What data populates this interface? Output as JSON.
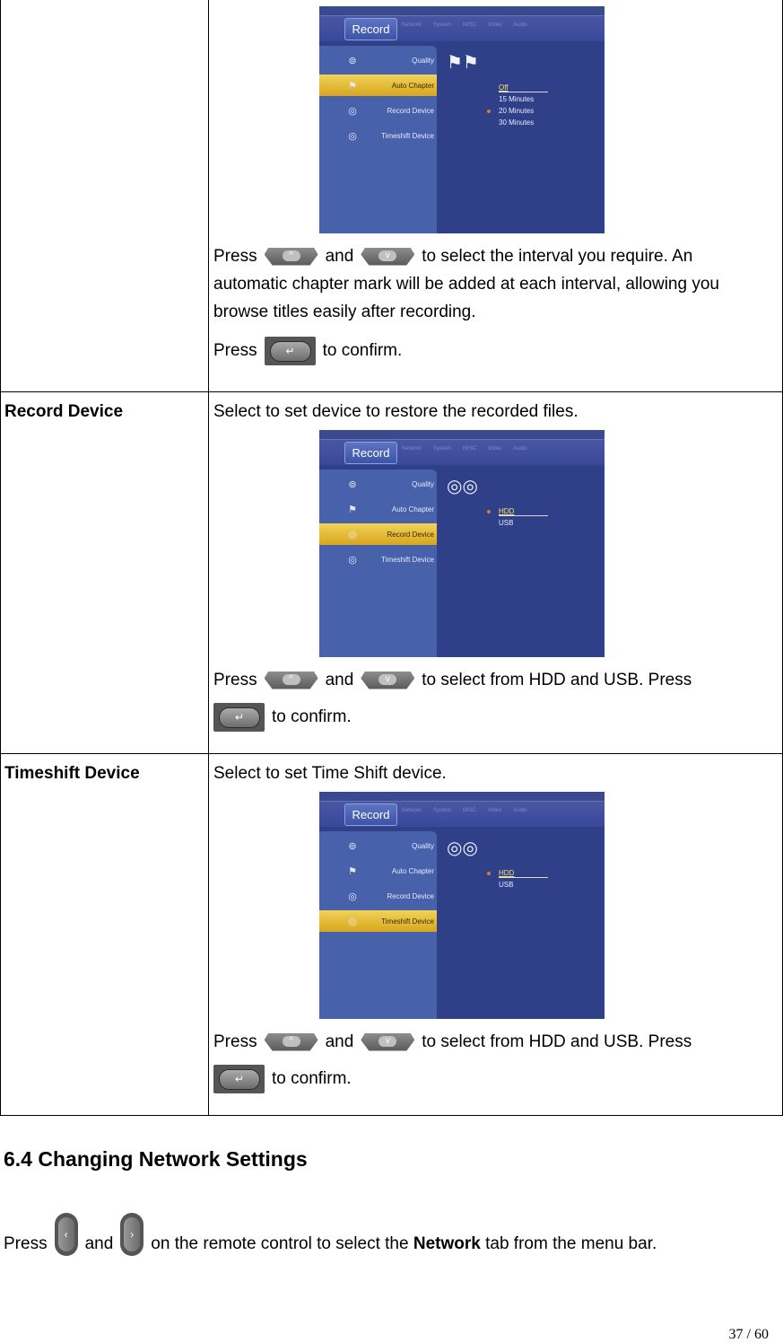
{
  "menu_tabs": [
    "Record",
    "Network",
    "System",
    "MISC",
    "Video",
    "Audio"
  ],
  "menu_items": [
    "Quality",
    "Auto Chapter",
    "Record Device",
    "Timeshift Device"
  ],
  "rows": [
    {
      "label": "",
      "screenshot": {
        "selected_item": "Auto Chapter",
        "options": [
          "Off",
          "15 Minutes",
          "20 Minutes",
          "30 Minutes"
        ],
        "highlighted_option": "Off",
        "marked_option": "20 Minutes"
      },
      "para1_pre": "Press",
      "para1_and": "and",
      "para1_post": "to select the interval you require. An",
      "para1_cont1": "automatic chapter mark will be added at each interval, allowing you",
      "para1_cont2": "browse titles easily after recording.",
      "para2_pre": "Press",
      "para2_post": "to confirm."
    },
    {
      "label": "Record Device",
      "intro": "Select to set device to restore the recorded files.",
      "screenshot": {
        "selected_item": "Record Device",
        "options": [
          "HDD",
          "USB"
        ],
        "highlighted_option": "HDD",
        "marked_option": "HDD"
      },
      "para1_pre": "Press",
      "para1_and": "and",
      "para1_post": "to select from HDD and USB. Press",
      "para2_post": "to confirm."
    },
    {
      "label": "Timeshift Device",
      "intro": "Select to set Time Shift device.",
      "screenshot": {
        "selected_item": "Timeshift Device",
        "options": [
          "HDD",
          "USB"
        ],
        "highlighted_option": "HDD",
        "marked_option": "HDD"
      },
      "para1_pre": "Press",
      "para1_and": "and",
      "para1_post": "to select from HDD and USB. Press",
      "para2_post": "to confirm."
    }
  ],
  "icons": {
    "up": "^",
    "down": "v",
    "left": "‹",
    "right": "›",
    "enter": "↵"
  },
  "section": {
    "title": "6.4 Changing Network Settings",
    "press": "Press",
    "and": "and",
    "rest_pre": "on the remote control to select the",
    "bold": "Network",
    "rest_post": "tab from the menu bar."
  },
  "page_number": "37 / 60"
}
